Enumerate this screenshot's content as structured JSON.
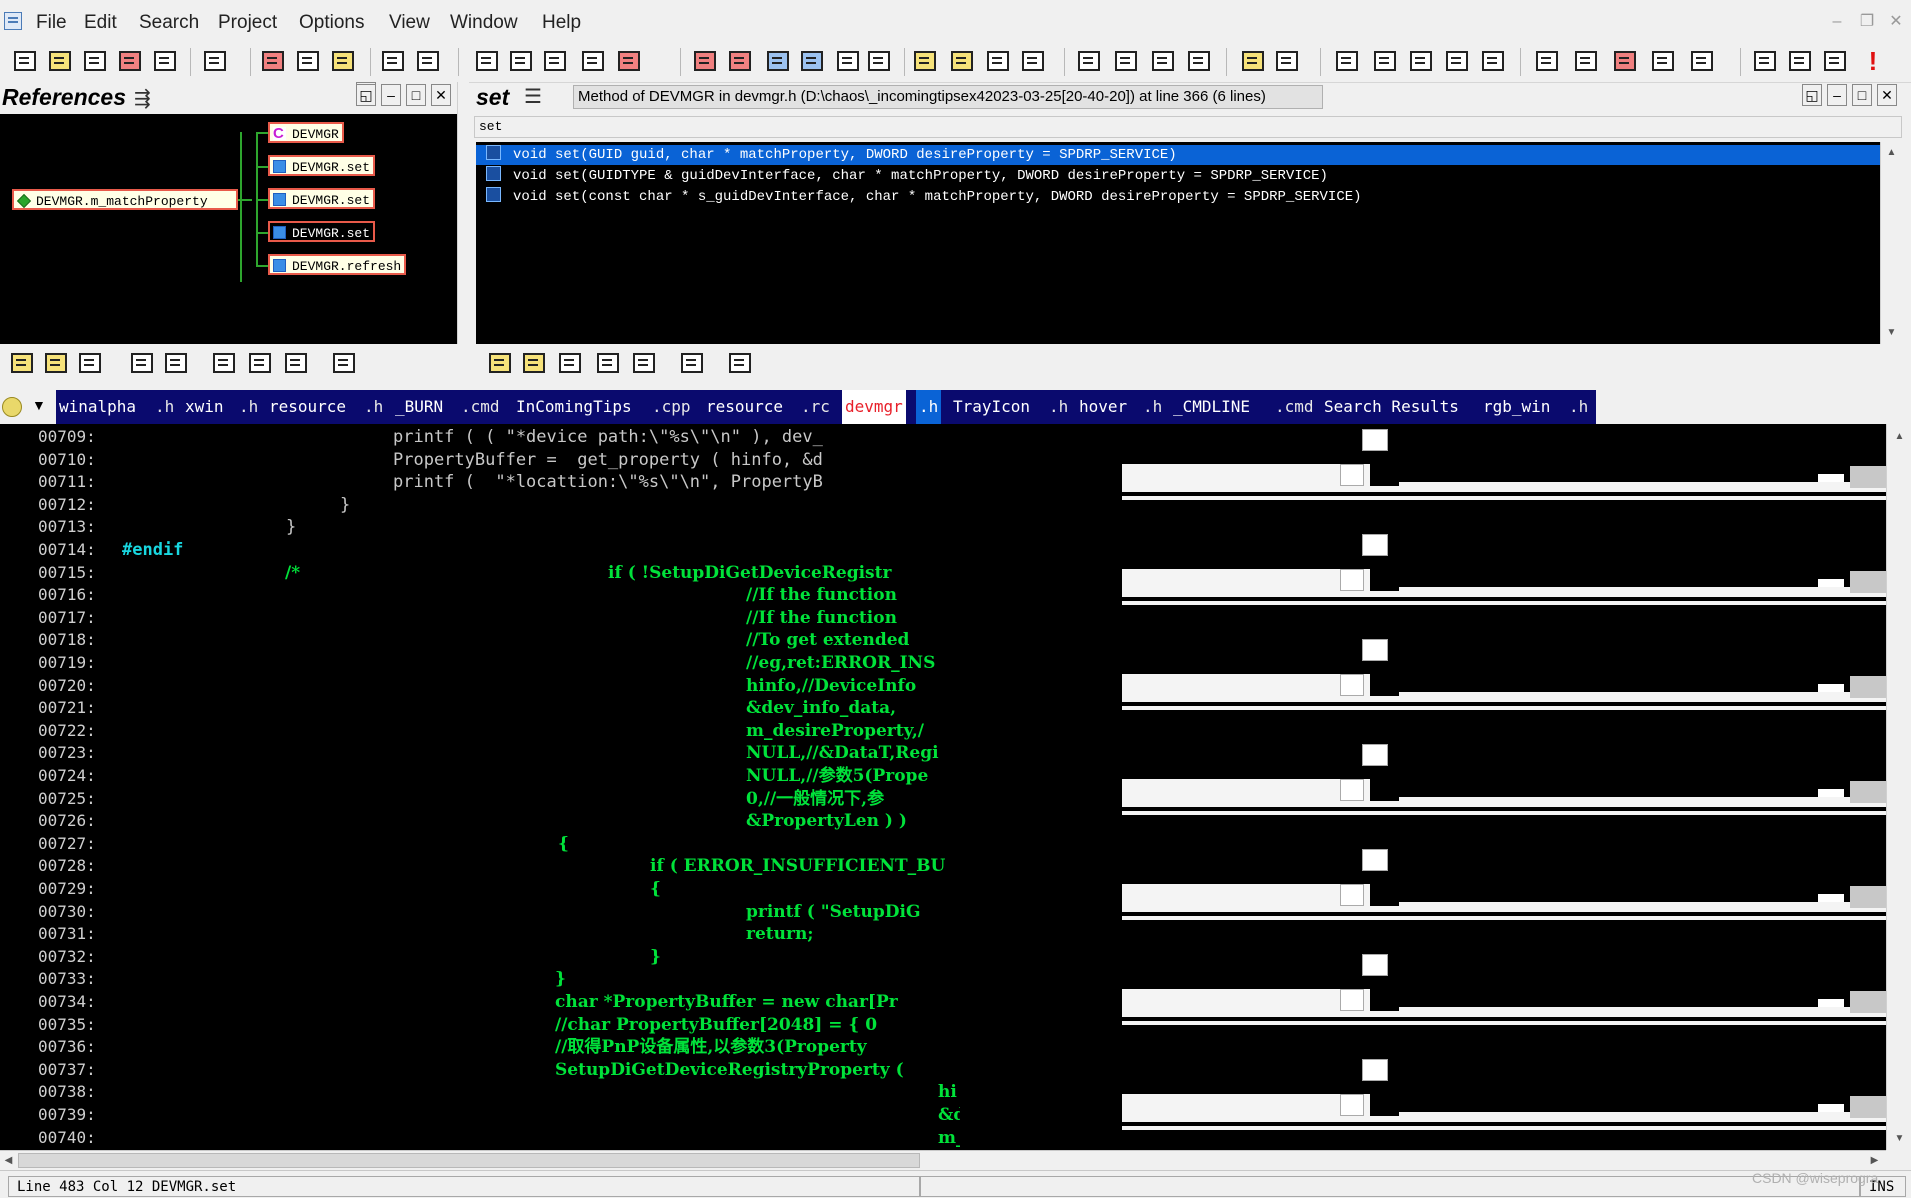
{
  "menu": [
    "File",
    "Edit",
    "Search",
    "Project",
    "Options",
    "View",
    "Window",
    "Help"
  ],
  "references": {
    "title": "References",
    "root": "DEVMGR.m_matchProperty",
    "children": [
      "DEVMGR",
      "DEVMGR.set",
      "DEVMGR.set",
      "DEVMGR.set",
      "DEVMGR.refresh"
    ]
  },
  "symbol_panel": {
    "title": "set",
    "info": "Method of DEVMGR in devmgr.h (D:\\chaos\\_incomingtipsex42023-03-25[20-40-20]) at line 366 (6 lines)",
    "filter": "set",
    "rows": [
      "void set(GUID guid, char * matchProperty, DWORD desireProperty = SPDRP_SERVICE)",
      "void set(GUIDTYPE & guidDevInterface, char * matchProperty, DWORD desireProperty = SPDRP_SERVICE)",
      "void set(const char * s_guidDevInterface, char * matchProperty, DWORD desireProperty = SPDRP_SERVICE)"
    ]
  },
  "tabs": [
    {
      "name": "winalpha",
      "ext": ".h"
    },
    {
      "name": "xwin",
      "ext": ".h"
    },
    {
      "name": "resource",
      "ext": ".h"
    },
    {
      "name": "_BURN",
      "ext": ".cmd"
    },
    {
      "name": "InComingTips",
      "ext": ".cpp"
    },
    {
      "name": "resource",
      "ext": ".rc"
    },
    {
      "name": "devmgr",
      "ext": ".h",
      "active": true
    },
    {
      "name": "TrayIcon",
      "ext": ".h"
    },
    {
      "name": "hover",
      "ext": ".h"
    },
    {
      "name": "_CMDLINE",
      "ext": ".cmd"
    },
    {
      "name": "Search Results",
      "ext": ""
    },
    {
      "name": "rgb_win",
      "ext": ".h"
    }
  ],
  "code_lines": [
    {
      "n": "00709:",
      "t": "printf ( ( \"*device path:\\\"%s\\\"\\n\" ), dev_",
      "c": "gray"
    },
    {
      "n": "00710:",
      "t": "PropertyBuffer =  get_property ( hinfo, &d",
      "c": "gray"
    },
    {
      "n": "00711:",
      "t": "printf (  \"*locattion:\\\"%s\\\"\\n\", PropertyB",
      "c": "gray"
    },
    {
      "n": "00712:",
      "t": "}",
      "c": "gray"
    },
    {
      "n": "00713:",
      "t": "}",
      "c": "gray"
    },
    {
      "n": "00714:",
      "t": "#endif",
      "c": "cyan"
    },
    {
      "n": "00715:",
      "t": "/*",
      "t2": "if ( !SetupDiGetDeviceRegistr",
      "c": "green"
    },
    {
      "n": "00716:",
      "t": "//If the function",
      "c": "green"
    },
    {
      "n": "00717:",
      "t": "//If the function",
      "c": "green"
    },
    {
      "n": "00718:",
      "t": "//To get extended",
      "c": "green"
    },
    {
      "n": "00719:",
      "t": "//eg,ret:ERROR_INS",
      "c": "green"
    },
    {
      "n": "00720:",
      "t": "hinfo,//DeviceInfo",
      "c": "green"
    },
    {
      "n": "00721:",
      "t": "&dev_info_data,",
      "c": "green"
    },
    {
      "n": "00722:",
      "t": "m_desireProperty,/",
      "c": "green"
    },
    {
      "n": "00723:",
      "t": "NULL,//&DataT,Regi",
      "c": "green"
    },
    {
      "n": "00724:",
      "t": "NULL,//参数5(Prope",
      "c": "green"
    },
    {
      "n": "00725:",
      "t": "0,//一般情况下,参",
      "c": "green"
    },
    {
      "n": "00726:",
      "t": "&PropertyLen ) )",
      "c": "green"
    },
    {
      "n": "00727:",
      "t": "{",
      "c": "green"
    },
    {
      "n": "00728:",
      "t": "if ( ERROR_INSUFFICIENT_BU",
      "c": "green"
    },
    {
      "n": "00729:",
      "t": "{",
      "c": "green"
    },
    {
      "n": "00730:",
      "t": "printf ( \"SetupDiG",
      "c": "green"
    },
    {
      "n": "00731:",
      "t": "return;",
      "c": "green"
    },
    {
      "n": "00732:",
      "t": "}",
      "c": "green"
    },
    {
      "n": "00733:",
      "t": "}",
      "c": "green"
    },
    {
      "n": "00734:",
      "t": "char *PropertyBuffer = new char[Pr",
      "c": "green"
    },
    {
      "n": "00735:",
      "t": "//char PropertyBuffer[2048] = { 0",
      "c": "green"
    },
    {
      "n": "00736:",
      "t": "//取得PnP设备属性,以参数3(Property",
      "c": "green"
    },
    {
      "n": "00737:",
      "t": "SetupDiGetDeviceRegistryProperty (",
      "c": "green"
    },
    {
      "n": "00738:",
      "t": "hi",
      "c": "green"
    },
    {
      "n": "00739:",
      "t": "&d",
      "c": "green"
    },
    {
      "n": "00740:",
      "t": "m_",
      "c": "green"
    }
  ],
  "status": {
    "position": "Line 483   Col 12    DEVMGR.set",
    "mode": "INS"
  },
  "watermark": "CSDN @wiseprogra"
}
